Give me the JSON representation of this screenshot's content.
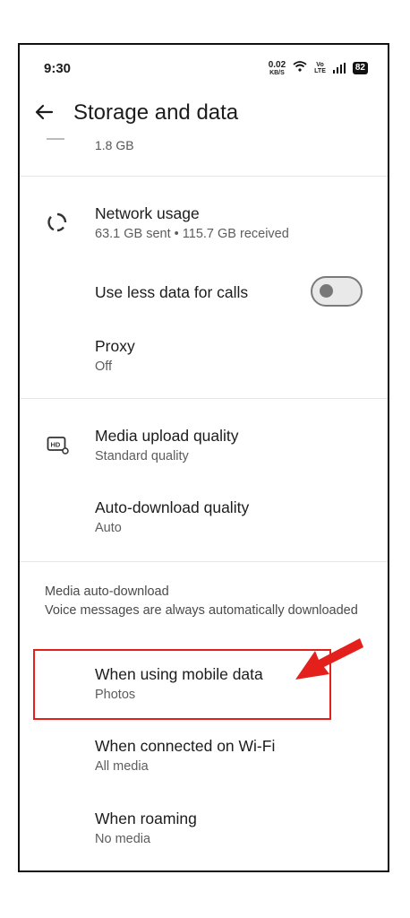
{
  "status": {
    "time": "9:30",
    "speed_value": "0.02",
    "speed_unit": "KB/S",
    "volte_top": "Vo",
    "volte_bottom": "LTE",
    "battery": "82"
  },
  "appbar": {
    "title": "Storage and data"
  },
  "storage": {
    "size": "1.8 GB"
  },
  "items": {
    "network_usage": {
      "title": "Network usage",
      "subtitle": "63.1 GB sent • 115.7 GB received"
    },
    "less_data_calls": {
      "title": "Use less data for calls",
      "enabled": false
    },
    "proxy": {
      "title": "Proxy",
      "subtitle": "Off"
    },
    "media_upload": {
      "title": "Media upload quality",
      "subtitle": "Standard quality"
    },
    "auto_download_quality": {
      "title": "Auto-download quality",
      "subtitle": "Auto"
    }
  },
  "auto_download": {
    "heading": "Media auto-download",
    "note": "Voice messages are always automatically downloaded",
    "mobile": {
      "title": "When using mobile data",
      "subtitle": "Photos"
    },
    "wifi": {
      "title": "When connected on Wi-Fi",
      "subtitle": "All media"
    },
    "roaming": {
      "title": "When roaming",
      "subtitle": "No media"
    }
  },
  "annotation": {
    "highlight_color": "#e3201b"
  }
}
